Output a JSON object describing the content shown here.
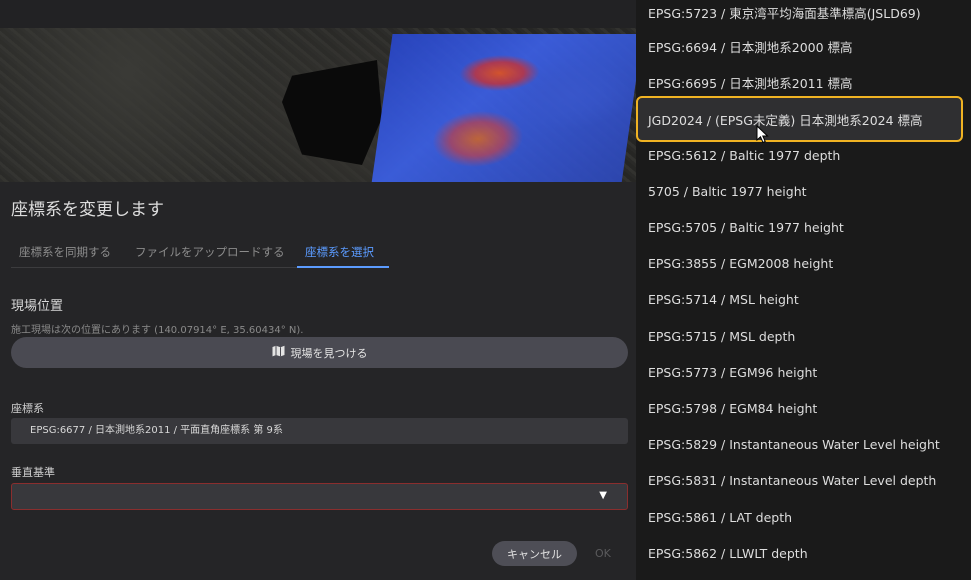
{
  "dialog": {
    "title": "座標系を変更します",
    "tabs": [
      {
        "label": "座標系を同期する"
      },
      {
        "label": "ファイルをアップロードする"
      },
      {
        "label": "座標系を選択"
      }
    ],
    "site": {
      "heading": "現場位置",
      "description": "施工現場は次の位置にあります (140.07914° E, 35.60434° N).",
      "find_button": "現場を見つける",
      "find_icon": "map-icon"
    },
    "crs": {
      "label": "座標系",
      "value": "EPSG:6677 / 日本測地系2011 / 平面直角座標系 第 9系"
    },
    "vertical": {
      "label": "垂直基準",
      "value": ""
    },
    "buttons": {
      "cancel": "キャンセル",
      "ok": "OK"
    }
  },
  "menu": {
    "items": [
      {
        "label": "EPSG:5723 / 東京湾平均海面基準標高(JSLD69)",
        "selected": false
      },
      {
        "label": "EPSG:6694 / 日本測地系2000 標高",
        "selected": false
      },
      {
        "label": "EPSG:6695 / 日本測地系2011 標高",
        "selected": false
      },
      {
        "label": "JGD2024 / (EPSG未定義) 日本測地系2024 標高",
        "selected": true
      },
      {
        "label": "EPSG:5612 / Baltic 1977 depth",
        "selected": false
      },
      {
        "label": "5705 / Baltic 1977 height",
        "selected": false
      },
      {
        "label": "EPSG:5705 / Baltic 1977 height",
        "selected": false
      },
      {
        "label": "EPSG:3855 / EGM2008 height",
        "selected": false
      },
      {
        "label": "EPSG:5714 / MSL height",
        "selected": false
      },
      {
        "label": "EPSG:5715 / MSL depth",
        "selected": false
      },
      {
        "label": "EPSG:5773 / EGM96 height",
        "selected": false
      },
      {
        "label": "EPSG:5798 / EGM84 height",
        "selected": false
      },
      {
        "label": "EPSG:5829 / Instantaneous Water Level height",
        "selected": false
      },
      {
        "label": "EPSG:5831 / Instantaneous Water Level depth",
        "selected": false
      },
      {
        "label": "EPSG:5861 / LAT depth",
        "selected": false
      },
      {
        "label": "EPSG:5862 / LLWLT depth",
        "selected": false
      }
    ]
  },
  "colors": {
    "accent": "#5b9bff",
    "highlight_border": "#f0b323",
    "error_border": "#8a2e2e"
  }
}
